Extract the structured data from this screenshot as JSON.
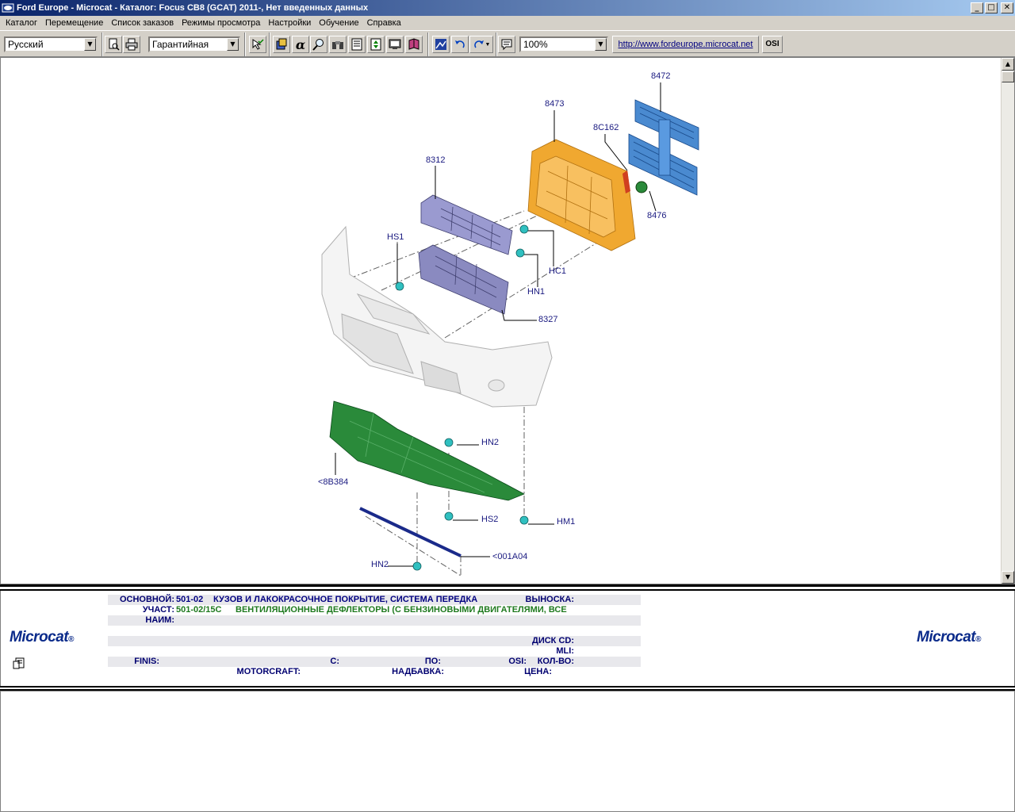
{
  "window": {
    "title": "Ford Europe - Microcat - Каталог: Focus CB8 (GCAT) 2011-, Нет введенных данных",
    "minimize": "_",
    "maximize": "□",
    "close": "✕"
  },
  "menu": [
    "Каталог",
    "Перемещение",
    "Список заказов",
    "Режимы просмотра",
    "Настройки",
    "Обучение",
    "Справка"
  ],
  "toolbar": {
    "language": "Русский",
    "mode": "Гарантийная",
    "zoom": "100%",
    "url": "http://www.fordeurope.microcat.net",
    "osi": "OSI"
  },
  "diagram": {
    "callouts": [
      "8472",
      "8473",
      "8C162",
      "8312",
      "8476",
      "HS1",
      "HC1",
      "HN1",
      "8327",
      "HN2",
      "<8B384",
      "HS2",
      "HM1",
      "<001A04",
      "HN2"
    ]
  },
  "logo": {
    "text": "Microcat",
    "reg": "®"
  },
  "info": {
    "main_label": "ОСНОВНОЙ:",
    "main_code": "501-02",
    "main_desc": "КУЗОВ И ЛАКОКРАСОЧНОЕ ПОКРЫТИЕ, СИСТЕМА ПЕРЕДКА",
    "callout_label": "ВЫНОСКА:",
    "section_label": "УЧАСТ:",
    "section_code": "501-02/15C",
    "section_desc": "ВЕНТИЛЯЦИОННЫЕ ДЕФЛЕКТОРЫ (С БЕНЗИНОВЫМИ ДВИГАТЕЛЯМИ, ВСЕ",
    "name_label": "НАИМ:",
    "cd_label": "ДИСК CD:",
    "mli_label": "MLI:",
    "finis_label": "FINIS:",
    "from_label": "С:",
    "to_label": "ПО:",
    "osi_label": "OSI:",
    "qty_label": "КОЛ-ВО:",
    "motorcraft_label": "MOTORCRAFT:",
    "markup_label": "НАДБАВКА:",
    "price_label": "ЦЕНА:"
  }
}
